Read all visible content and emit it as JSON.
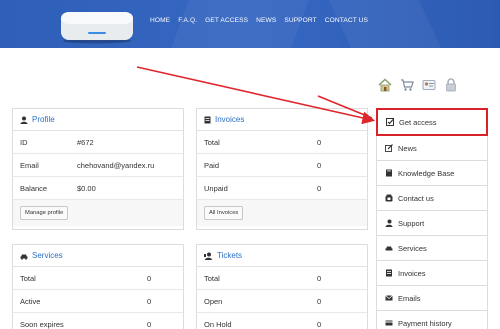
{
  "nav": [
    "HOME",
    "F.A.Q.",
    "GET ACCESS",
    "NEWS",
    "SUPPORT",
    "CONTACT US"
  ],
  "profile": {
    "title": "Profile",
    "rows": [
      {
        "k": "ID",
        "v": "#672"
      },
      {
        "k": "Email",
        "v": "chehovand@yandex.ru"
      },
      {
        "k": "Balance",
        "v": "$0.00"
      }
    ],
    "button": "Manage profile"
  },
  "invoices": {
    "title": "Invoices",
    "rows": [
      {
        "k": "Total",
        "v": "0"
      },
      {
        "k": "Paid",
        "v": "0"
      },
      {
        "k": "Unpaid",
        "v": "0"
      }
    ],
    "button": "All Invoices"
  },
  "services": {
    "title": "Services",
    "rows": [
      {
        "k": "Total",
        "v": "0"
      },
      {
        "k": "Active",
        "v": "0"
      },
      {
        "k": "Soon expires",
        "v": "0"
      }
    ]
  },
  "tickets": {
    "title": "Tickets",
    "rows": [
      {
        "k": "Total",
        "v": "0"
      },
      {
        "k": "Open",
        "v": "0"
      },
      {
        "k": "On Hold",
        "v": "0"
      }
    ]
  },
  "sidebar": [
    {
      "label": "Get access",
      "icon": "checkbox-icon"
    },
    {
      "label": "News",
      "icon": "edit-icon"
    },
    {
      "label": "Knowledge Base",
      "icon": "book-icon"
    },
    {
      "label": "Contact us",
      "icon": "phone-icon"
    },
    {
      "label": "Support",
      "icon": "support-icon"
    },
    {
      "label": "Services",
      "icon": "car-icon"
    },
    {
      "label": "Invoices",
      "icon": "invoice-icon"
    },
    {
      "label": "Emails",
      "icon": "envelope-icon"
    },
    {
      "label": "Payment history",
      "icon": "payment-icon"
    }
  ],
  "topicons": [
    "home-icon",
    "cart-icon",
    "id-card-icon",
    "lock-icon"
  ],
  "colors": {
    "header": "#3262bd",
    "link": "#2a6fc9",
    "highlight": "#d9232a"
  }
}
